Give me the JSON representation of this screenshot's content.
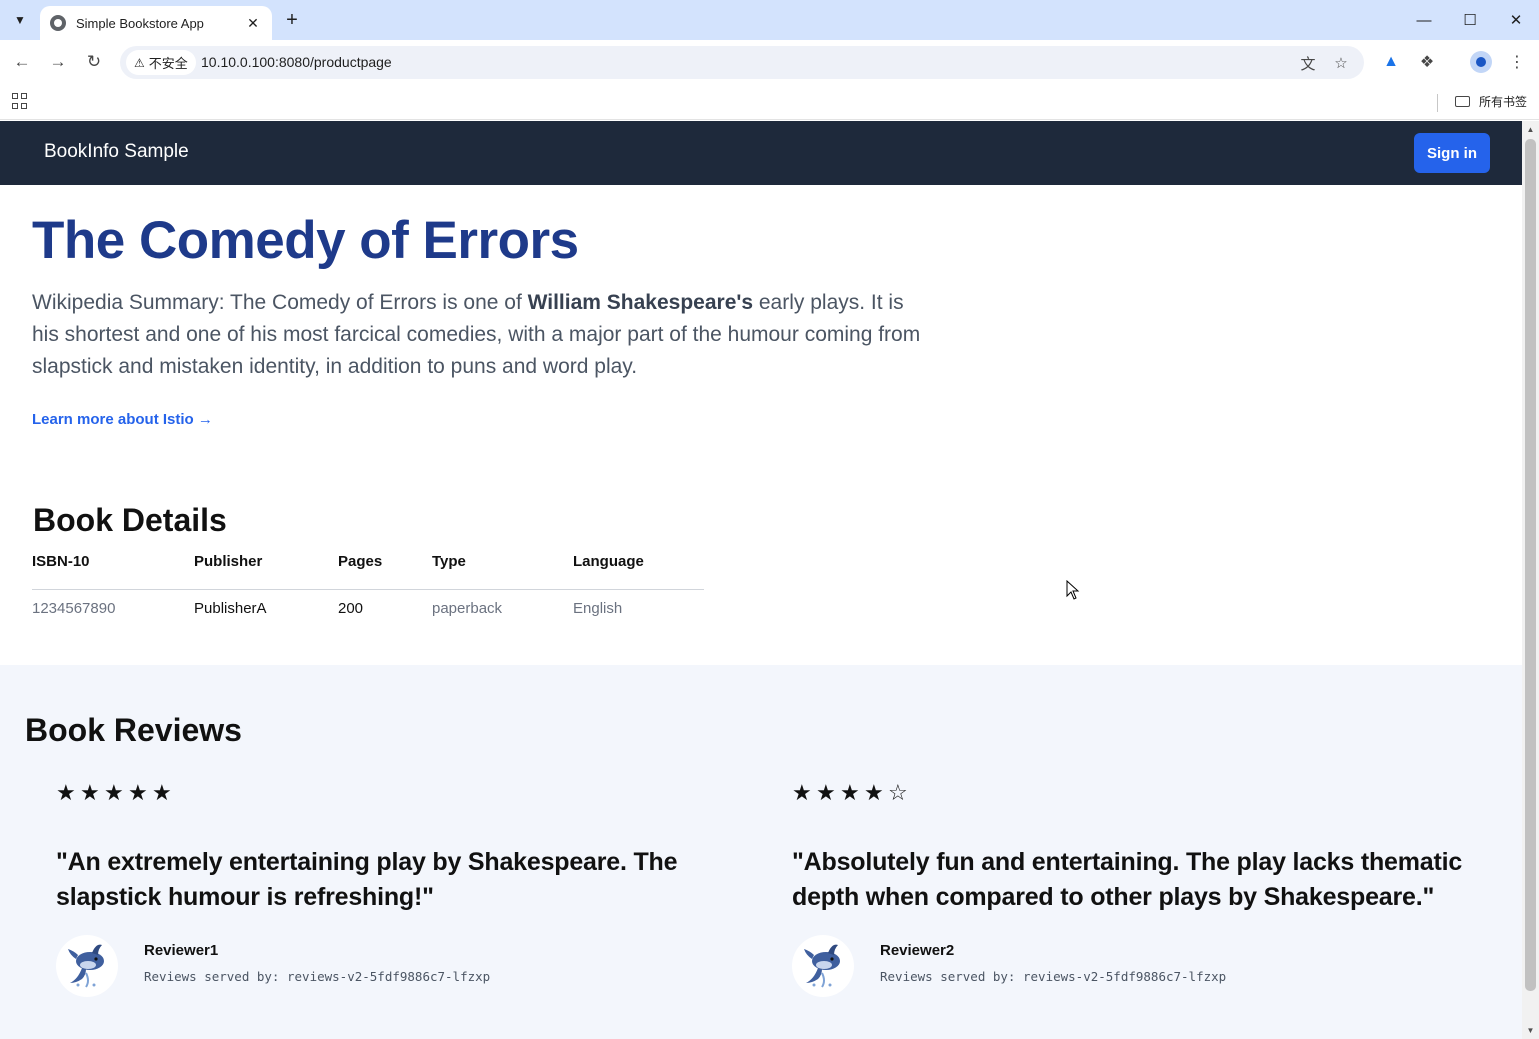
{
  "browser": {
    "tab_title": "Simple Bookstore App",
    "security_label": "不安全",
    "url": "10.10.0.100:8080/productpage",
    "all_bookmarks": "所有书签"
  },
  "site": {
    "brand": "BookInfo Sample",
    "signin_label": "Sign in"
  },
  "hero": {
    "title": "The Comedy of Errors",
    "summary_prefix": "Wikipedia Summary: The Comedy of Errors is one of ",
    "summary_bold": "William Shakespeare's",
    "summary_suffix": " early plays. It is his shortest and one of his most farcical comedies, with a major part of the humour coming from slapstick and mistaken identity, in addition to puns and word play.",
    "learn_more": "Learn more about Istio →"
  },
  "details": {
    "title": "Book Details",
    "headers": [
      "ISBN-10",
      "Publisher",
      "Pages",
      "Type",
      "Language"
    ],
    "row": [
      "1234567890",
      "PublisherA",
      "200",
      "paperback",
      "English"
    ]
  },
  "reviews": {
    "title": "Book Reviews",
    "items": [
      {
        "rating": 5,
        "max_rating": 5,
        "star_color": "#111111",
        "quote": "\"An extremely entertaining play by Shakespeare. The slapstick humour is refreshing!\"",
        "reviewer": "Reviewer1",
        "served_by": "Reviews served by: reviews-v2-5fdf9886c7-lfzxp"
      },
      {
        "rating": 4,
        "max_rating": 5,
        "star_color": "#111111",
        "quote": "\"Absolutely fun and entertaining. The play lacks thematic depth when compared to other plays by Shakespeare.\"",
        "reviewer": "Reviewer2",
        "served_by": "Reviews served by: reviews-v2-5fdf9886c7-lfzxp"
      }
    ]
  },
  "colors": {
    "nav_bg": "#1e293b",
    "title_blue": "#1e3a8a",
    "accent_blue": "#2563eb",
    "reviews_bg": "#f3f6fc"
  },
  "icons": {
    "tab_search": "chevron-down-icon",
    "favicon": "globe-icon",
    "tab_close": "close-icon",
    "new_tab": "plus-icon",
    "back": "arrow-left-icon",
    "forward": "arrow-right-icon",
    "reload": "reload-icon",
    "warning": "warning-icon",
    "translate": "translate-icon",
    "bookmark": "star-icon",
    "extensions": "puzzle-icon",
    "profile": "profile-icon",
    "menu": "kebab-menu-icon",
    "apps": "apps-grid-icon",
    "folder": "folder-icon",
    "reviewer_avatar": "dolphin-icon"
  }
}
